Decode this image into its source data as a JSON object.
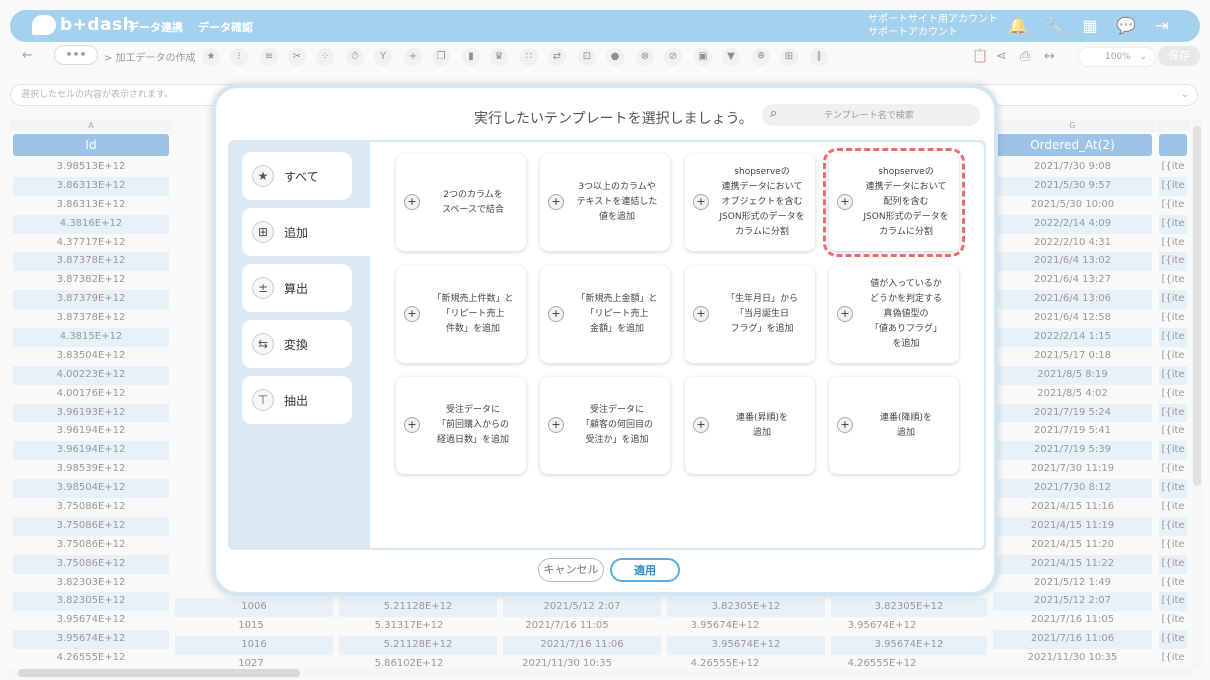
{
  "header": {
    "logo": "b+dash",
    "nav": [
      "データ連携",
      "データ確認"
    ],
    "support_line1": "サポートサイト用アカウント",
    "support_line2": "サポートアカウント"
  },
  "toolbar": {
    "more": "•••",
    "breadcrumb": "> 加工データの作成",
    "zoom": "100%",
    "save": "保存"
  },
  "infobar": {
    "text": "選択したセルの内容が表示されます。"
  },
  "grid": {
    "col_a_letter": "A",
    "col_a_title": "Id",
    "col_g_letter": "G",
    "col_g_title": "Ordered_At(2)",
    "col_a_values": [
      "3.98513E+12",
      "3.86313E+12",
      "3.86313E+12",
      "4.3816E+12",
      "4.37717E+12",
      "3.87378E+12",
      "3.87382E+12",
      "3.87379E+12",
      "3.87378E+12",
      "4.3815E+12",
      "3.83504E+12",
      "4.00223E+12",
      "4.00176E+12",
      "3.96193E+12",
      "3.96194E+12",
      "3.96194E+12",
      "3.98539E+12",
      "3.98504E+12",
      "3.75086E+12",
      "3.75086E+12",
      "3.75086E+12",
      "3.75086E+12",
      "3.82303E+12",
      "3.82305E+12",
      "3.95674E+12",
      "3.95674E+12",
      "4.26555E+12"
    ],
    "col_g_values": [
      "2021/7/30 9:08",
      "2021/5/30 9:57",
      "2021/5/30 10:00",
      "2022/2/14 4:09",
      "2022/2/10 4:31",
      "2021/6/4 13:02",
      "2021/6/4 13:27",
      "2021/6/4 13:06",
      "2021/6/4 12:58",
      "2022/2/14 1:15",
      "2021/5/17 0:18",
      "2021/8/5 8:19",
      "2021/8/5 4:02",
      "2021/7/19 5:24",
      "2021/7/19 5:41",
      "2021/7/19 5:39",
      "2021/7/30 11:19",
      "2021/7/30 8:12",
      "2021/4/15 11:16",
      "2021/4/15 11:19",
      "2021/4/15 11:20",
      "2021/4/15 11:22",
      "2021/5/12 1:49",
      "2021/5/12 2:07",
      "2021/7/16 11:05",
      "2021/7/16 11:06",
      "2021/11/30 10:35"
    ],
    "col_h_values": [
      "[{ite",
      "[{ite",
      "[{ite",
      "[{ite",
      "[{ite",
      "[{ite",
      "[{ite",
      "[{ite",
      "[{ite",
      "[{ite",
      "[{ite",
      "[{ite",
      "[{ite",
      "[{ite",
      "[{ite",
      "[{ite",
      "[{ite",
      "[{ite",
      "[{ite",
      "[{ite",
      "[{ite",
      "[{ite",
      "[{ite",
      "[{ite",
      "[{ite",
      "[{ite",
      "[{ite"
    ],
    "bottom_rows": [
      [
        "1006",
        "5.21128E+12",
        "2021/5/12 2:07",
        "3.82305E+12",
        "3.82305E+12"
      ],
      [
        "1015",
        "5.31317E+12",
        "2021/7/16 11:05",
        "3.95674E+12",
        "3.95674E+12"
      ],
      [
        "1016",
        "5.21128E+12",
        "2021/7/16 11:06",
        "3.95674E+12",
        "3.95674E+12"
      ],
      [
        "1027",
        "5.86102E+12",
        "2021/11/30 10:35",
        "4.26555E+12",
        "4.26555E+12"
      ]
    ]
  },
  "modal": {
    "title": "実行したいテンプレートを選択しましょう。",
    "search_placeholder": "テンプレート名で検索",
    "categories": [
      "すべて",
      "追加",
      "算出",
      "変換",
      "抽出"
    ],
    "templates": [
      "2つのカラムを\nスペースで結合",
      "3つ以上のカラムや\nテキストを連結した\n値を追加",
      "shopserveの\n連携データにおいて\nオブジェクトを含む\nJSON形式のデータを\nカラムに分割",
      "shopserveの\n連携データにおいて\n配列を含む\nJSON形式のデータを\nカラムに分割",
      "「新規売上件数」と\n「リピート売上\n件数」を追加",
      "「新規売上金額」と\n「リピート売上\n金額」を追加",
      "「生年月日」から\n「当月誕生日\nフラグ」を追加",
      "値が入っているか\nどうかを判定する\n真偽値型の\n「値ありフラグ」\nを追加",
      "受注データに\n「前回購入からの\n経過日数」を追加",
      "受注データに\n「顧客の何回目の\n受注か」を追加",
      "連番(昇順)を\n追加",
      "連番(降順)を\n追加"
    ],
    "cancel": "キャンセル",
    "apply": "適用"
  },
  "colors": {
    "accent": "#5aace0",
    "highlight": "#ee6b73",
    "column_header": "#4f93d8"
  }
}
